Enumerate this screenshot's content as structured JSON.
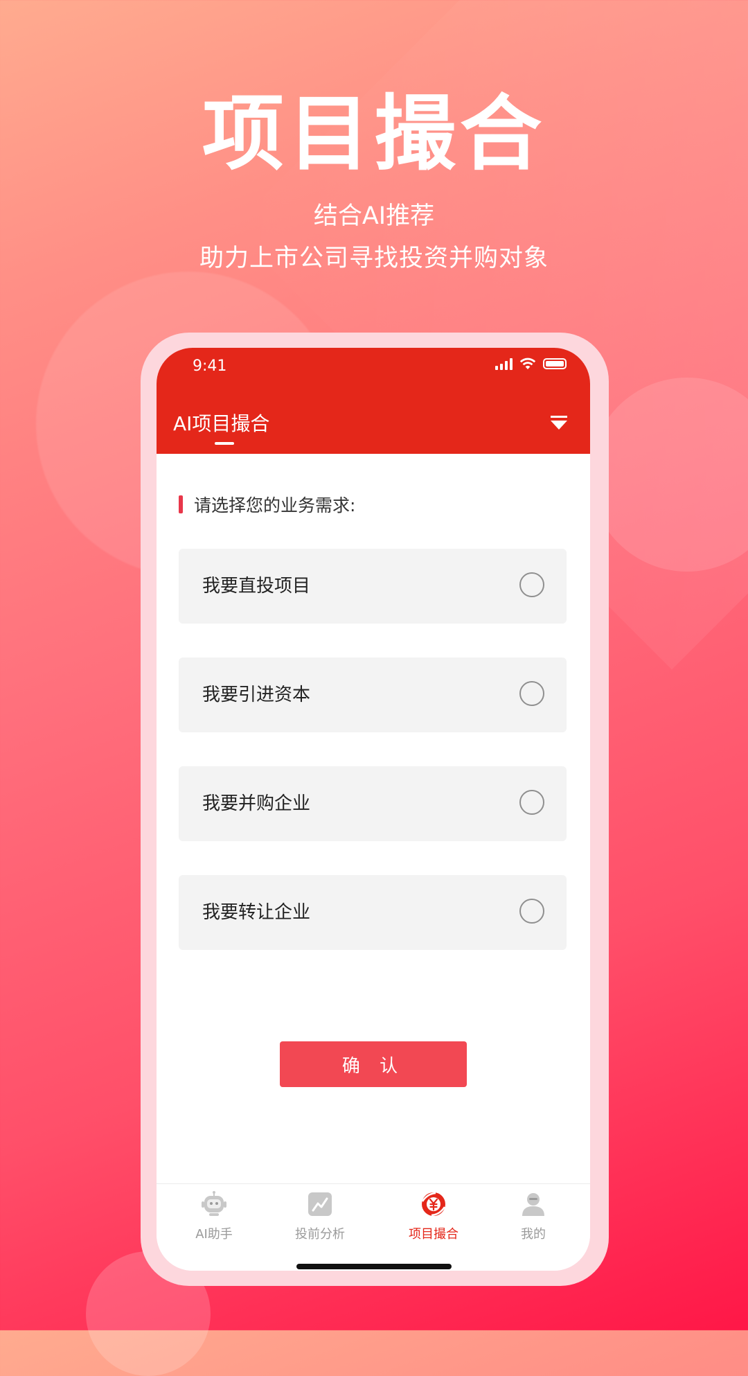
{
  "promo": {
    "headline": "项目撮合",
    "subline1": "结合AI推荐",
    "subline2": "助力上市公司寻找投资并购对象"
  },
  "status_bar": {
    "time": "9:41"
  },
  "nav": {
    "title": "AI项目撮合"
  },
  "section": {
    "title": "请选择您的业务需求:"
  },
  "options": [
    {
      "label": "我要直投项目",
      "selected": false
    },
    {
      "label": "我要引进资本",
      "selected": false
    },
    {
      "label": "我要并购企业",
      "selected": false
    },
    {
      "label": "我要转让企业",
      "selected": false
    }
  ],
  "confirm_label": "确 认",
  "tabs": [
    {
      "label": "AI助手",
      "icon": "robot-icon",
      "active": false
    },
    {
      "label": "投前分析",
      "icon": "chart-icon",
      "active": false
    },
    {
      "label": "项目撮合",
      "icon": "yuan-exchange-icon",
      "active": true
    },
    {
      "label": "我的",
      "icon": "user-icon",
      "active": false
    }
  ],
  "colors": {
    "brand_red": "#e4271a",
    "button_red": "#f24853",
    "tab_inactive": "#9a9a9a"
  }
}
